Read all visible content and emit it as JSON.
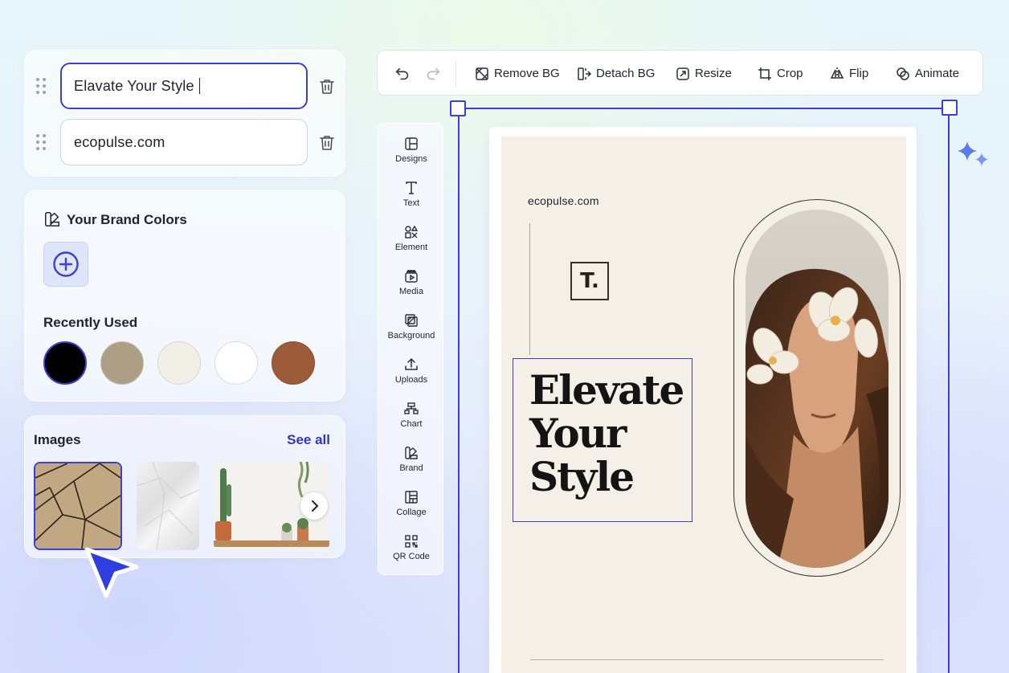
{
  "text_fields": [
    {
      "value": "Elavate Your Style",
      "active": true
    },
    {
      "value": "ecopulse.com",
      "active": false
    }
  ],
  "brand": {
    "title": "Your Brand Colors",
    "recent_label": "Recently Used",
    "recent_colors": [
      "#000000",
      "#ad9f86",
      "#f2efe6",
      "#ffffff",
      "#9c5c3a"
    ],
    "accent": "#3b3fd6"
  },
  "images": {
    "title": "Images",
    "see_all": "See all",
    "thumbs": [
      "geometric-stone-texture",
      "crumpled-paper-texture",
      "cactus-shelf-scene"
    ]
  },
  "toolbar": {
    "undo_icon": "undo-icon",
    "redo_icon": "redo-icon",
    "remove_bg": "Remove BG",
    "detach_bg": "Detach BG",
    "resize": "Resize",
    "crop": "Crop",
    "flip": "Flip",
    "animate": "Animate"
  },
  "rail": [
    {
      "label": "Designs",
      "icon": "layout-icon"
    },
    {
      "label": "Text",
      "icon": "text-icon"
    },
    {
      "label": "Element",
      "icon": "shapes-icon"
    },
    {
      "label": "Media",
      "icon": "media-icon"
    },
    {
      "label": "Background",
      "icon": "background-icon"
    },
    {
      "label": "Uploads",
      "icon": "upload-icon"
    },
    {
      "label": "Chart",
      "icon": "chart-icon"
    },
    {
      "label": "Brand",
      "icon": "brand-icon"
    },
    {
      "label": "Collage",
      "icon": "collage-icon"
    },
    {
      "label": "QR Code",
      "icon": "qr-code-icon"
    }
  ],
  "design": {
    "domain": "ecopulse.com",
    "logo_letter": "T.",
    "headline": [
      "Elevate",
      "Your",
      "Style"
    ]
  }
}
